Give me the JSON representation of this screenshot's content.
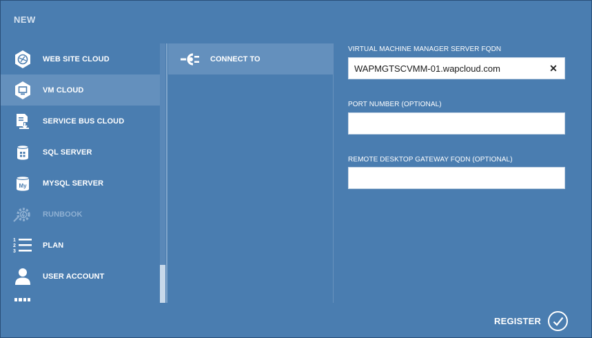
{
  "dialog": {
    "title": "NEW"
  },
  "nav": {
    "items": [
      {
        "label": "WEB SITE CLOUD",
        "icon": "web-site-cloud-icon",
        "selected": false,
        "disabled": false
      },
      {
        "label": "VM CLOUD",
        "icon": "vm-cloud-icon",
        "selected": true,
        "disabled": false
      },
      {
        "label": "SERVICE BUS CLOUD",
        "icon": "service-bus-icon",
        "selected": false,
        "disabled": false
      },
      {
        "label": "SQL SERVER",
        "icon": "sql-server-icon",
        "selected": false,
        "disabled": false
      },
      {
        "label": "MYSQL SERVER",
        "icon": "mysql-server-icon",
        "selected": false,
        "disabled": false
      },
      {
        "label": "RUNBOOK",
        "icon": "runbook-icon",
        "selected": false,
        "disabled": true
      },
      {
        "label": "PLAN",
        "icon": "plan-list-icon",
        "selected": false,
        "disabled": false
      },
      {
        "label": "USER ACCOUNT",
        "icon": "user-account-icon",
        "selected": false,
        "disabled": false
      }
    ]
  },
  "steps": {
    "connect_to": "CONNECT TO"
  },
  "form": {
    "vmm_fqdn_label": "VIRTUAL MACHINE MANAGER SERVER FQDN",
    "vmm_fqdn_value": "WAPMGTSCVMM-01.wapcloud.com",
    "port_label": "PORT NUMBER (OPTIONAL)",
    "port_value": "",
    "rdg_label": "REMOTE DESKTOP GATEWAY FQDN (OPTIONAL)",
    "rdg_value": "",
    "clear_glyph": "✕"
  },
  "footer": {
    "register_label": "REGISTER"
  },
  "colors": {
    "background": "#4a7db0",
    "selected": "#6490bd",
    "disabled_text": "#8fb0d2"
  }
}
